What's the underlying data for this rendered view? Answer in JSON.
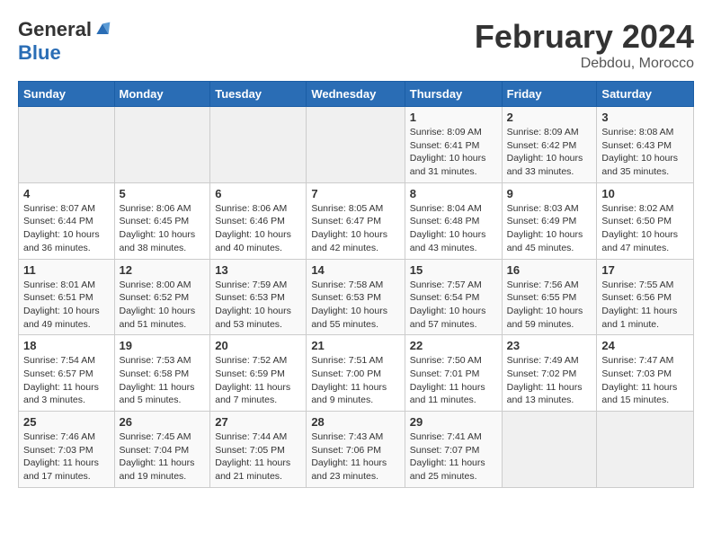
{
  "logo": {
    "general": "General",
    "blue": "Blue"
  },
  "title": "February 2024",
  "location": "Debdou, Morocco",
  "days_header": [
    "Sunday",
    "Monday",
    "Tuesday",
    "Wednesday",
    "Thursday",
    "Friday",
    "Saturday"
  ],
  "weeks": [
    [
      {
        "num": "",
        "info": ""
      },
      {
        "num": "",
        "info": ""
      },
      {
        "num": "",
        "info": ""
      },
      {
        "num": "",
        "info": ""
      },
      {
        "num": "1",
        "info": "Sunrise: 8:09 AM\nSunset: 6:41 PM\nDaylight: 10 hours and 31 minutes."
      },
      {
        "num": "2",
        "info": "Sunrise: 8:09 AM\nSunset: 6:42 PM\nDaylight: 10 hours and 33 minutes."
      },
      {
        "num": "3",
        "info": "Sunrise: 8:08 AM\nSunset: 6:43 PM\nDaylight: 10 hours and 35 minutes."
      }
    ],
    [
      {
        "num": "4",
        "info": "Sunrise: 8:07 AM\nSunset: 6:44 PM\nDaylight: 10 hours and 36 minutes."
      },
      {
        "num": "5",
        "info": "Sunrise: 8:06 AM\nSunset: 6:45 PM\nDaylight: 10 hours and 38 minutes."
      },
      {
        "num": "6",
        "info": "Sunrise: 8:06 AM\nSunset: 6:46 PM\nDaylight: 10 hours and 40 minutes."
      },
      {
        "num": "7",
        "info": "Sunrise: 8:05 AM\nSunset: 6:47 PM\nDaylight: 10 hours and 42 minutes."
      },
      {
        "num": "8",
        "info": "Sunrise: 8:04 AM\nSunset: 6:48 PM\nDaylight: 10 hours and 43 minutes."
      },
      {
        "num": "9",
        "info": "Sunrise: 8:03 AM\nSunset: 6:49 PM\nDaylight: 10 hours and 45 minutes."
      },
      {
        "num": "10",
        "info": "Sunrise: 8:02 AM\nSunset: 6:50 PM\nDaylight: 10 hours and 47 minutes."
      }
    ],
    [
      {
        "num": "11",
        "info": "Sunrise: 8:01 AM\nSunset: 6:51 PM\nDaylight: 10 hours and 49 minutes."
      },
      {
        "num": "12",
        "info": "Sunrise: 8:00 AM\nSunset: 6:52 PM\nDaylight: 10 hours and 51 minutes."
      },
      {
        "num": "13",
        "info": "Sunrise: 7:59 AM\nSunset: 6:53 PM\nDaylight: 10 hours and 53 minutes."
      },
      {
        "num": "14",
        "info": "Sunrise: 7:58 AM\nSunset: 6:53 PM\nDaylight: 10 hours and 55 minutes."
      },
      {
        "num": "15",
        "info": "Sunrise: 7:57 AM\nSunset: 6:54 PM\nDaylight: 10 hours and 57 minutes."
      },
      {
        "num": "16",
        "info": "Sunrise: 7:56 AM\nSunset: 6:55 PM\nDaylight: 10 hours and 59 minutes."
      },
      {
        "num": "17",
        "info": "Sunrise: 7:55 AM\nSunset: 6:56 PM\nDaylight: 11 hours and 1 minute."
      }
    ],
    [
      {
        "num": "18",
        "info": "Sunrise: 7:54 AM\nSunset: 6:57 PM\nDaylight: 11 hours and 3 minutes."
      },
      {
        "num": "19",
        "info": "Sunrise: 7:53 AM\nSunset: 6:58 PM\nDaylight: 11 hours and 5 minutes."
      },
      {
        "num": "20",
        "info": "Sunrise: 7:52 AM\nSunset: 6:59 PM\nDaylight: 11 hours and 7 minutes."
      },
      {
        "num": "21",
        "info": "Sunrise: 7:51 AM\nSunset: 7:00 PM\nDaylight: 11 hours and 9 minutes."
      },
      {
        "num": "22",
        "info": "Sunrise: 7:50 AM\nSunset: 7:01 PM\nDaylight: 11 hours and 11 minutes."
      },
      {
        "num": "23",
        "info": "Sunrise: 7:49 AM\nSunset: 7:02 PM\nDaylight: 11 hours and 13 minutes."
      },
      {
        "num": "24",
        "info": "Sunrise: 7:47 AM\nSunset: 7:03 PM\nDaylight: 11 hours and 15 minutes."
      }
    ],
    [
      {
        "num": "25",
        "info": "Sunrise: 7:46 AM\nSunset: 7:03 PM\nDaylight: 11 hours and 17 minutes."
      },
      {
        "num": "26",
        "info": "Sunrise: 7:45 AM\nSunset: 7:04 PM\nDaylight: 11 hours and 19 minutes."
      },
      {
        "num": "27",
        "info": "Sunrise: 7:44 AM\nSunset: 7:05 PM\nDaylight: 11 hours and 21 minutes."
      },
      {
        "num": "28",
        "info": "Sunrise: 7:43 AM\nSunset: 7:06 PM\nDaylight: 11 hours and 23 minutes."
      },
      {
        "num": "29",
        "info": "Sunrise: 7:41 AM\nSunset: 7:07 PM\nDaylight: 11 hours and 25 minutes."
      },
      {
        "num": "",
        "info": ""
      },
      {
        "num": "",
        "info": ""
      }
    ]
  ]
}
